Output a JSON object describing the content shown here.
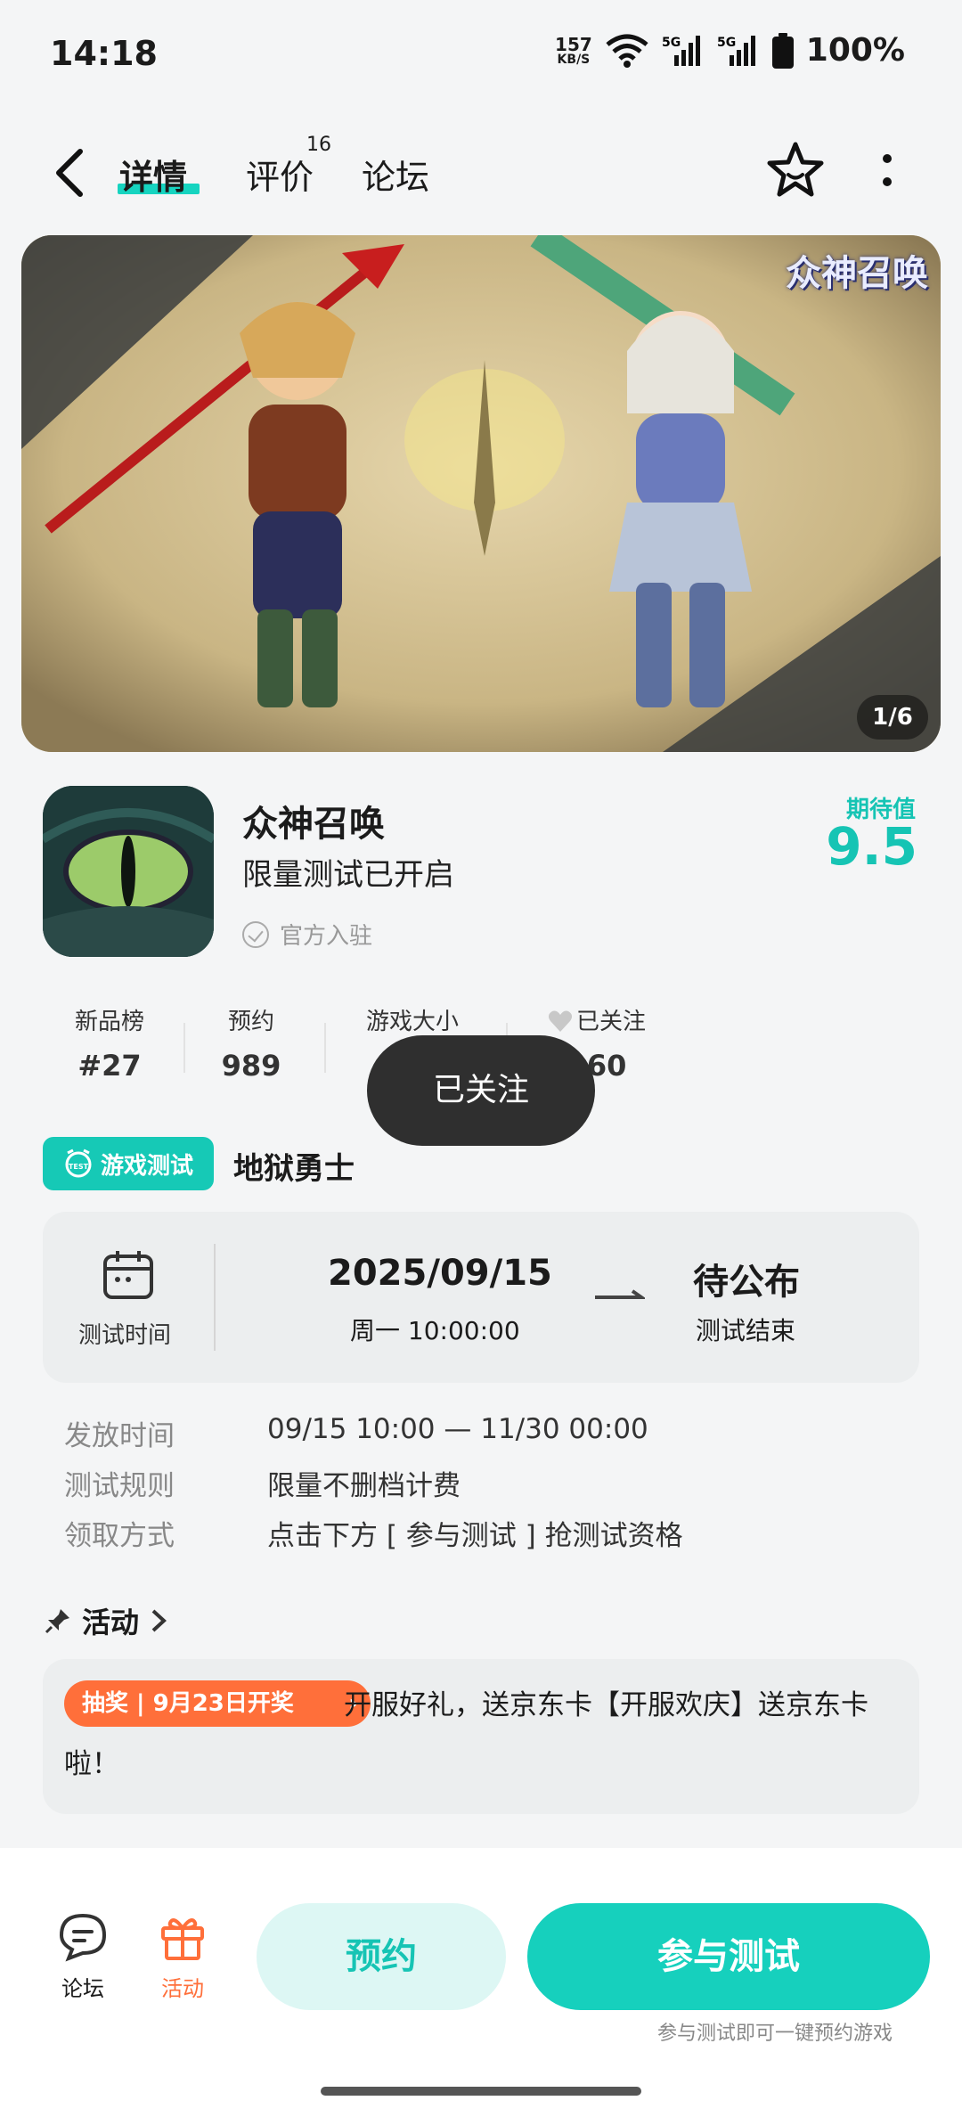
{
  "status_bar": {
    "time": "14:18",
    "speed_value": "157",
    "speed_unit": "KB/S",
    "battery": "100%"
  },
  "nav": {
    "tabs": [
      "详情",
      "评价",
      "论坛"
    ],
    "review_count": "16"
  },
  "banner": {
    "logo_text": "众神召唤",
    "pager": "1/6"
  },
  "app": {
    "name": "众神召唤",
    "subtitle": "限量测试已开启",
    "official": "官方入驻",
    "expect_label": "期待值",
    "expect_value": "9.5"
  },
  "stats": [
    {
      "label": "新品榜",
      "value": "#27"
    },
    {
      "label": "预约",
      "value": "989"
    },
    {
      "label": "游戏大小",
      "value": ""
    },
    {
      "label": "已关注",
      "value": "960"
    }
  ],
  "toast": "已关注",
  "test": {
    "tag": "游戏测试",
    "tag_icon_text": "TEST",
    "name": "地狱勇士",
    "time_label": "测试时间",
    "start_date": "2025/09/15",
    "start_time": "周一 10:00:00",
    "end_value": "待公布",
    "end_label": "测试结束"
  },
  "info": [
    {
      "key": "发放时间",
      "value": "09/15 10:00 — 11/30 00:00"
    },
    {
      "key": "测试规则",
      "value": "限量不删档计费"
    },
    {
      "key": "领取方式",
      "value": "点击下方 [ 参与测试 ] 抢测试资格"
    }
  ],
  "activity": {
    "title": "活动",
    "pill": "抽奖 | 9月23日开奖",
    "line1": "开服好礼，送京东卡【开服欢庆】送京东卡",
    "line2": "啦！"
  },
  "bottom": {
    "forum_label": "论坛",
    "activity_label": "活动",
    "reserve_label": "预约",
    "join_label": "参与测试",
    "join_note": "参与测试即可一键预约游戏"
  },
  "colors": {
    "accent": "#16d0bd",
    "orange": "#ff6f3a"
  }
}
